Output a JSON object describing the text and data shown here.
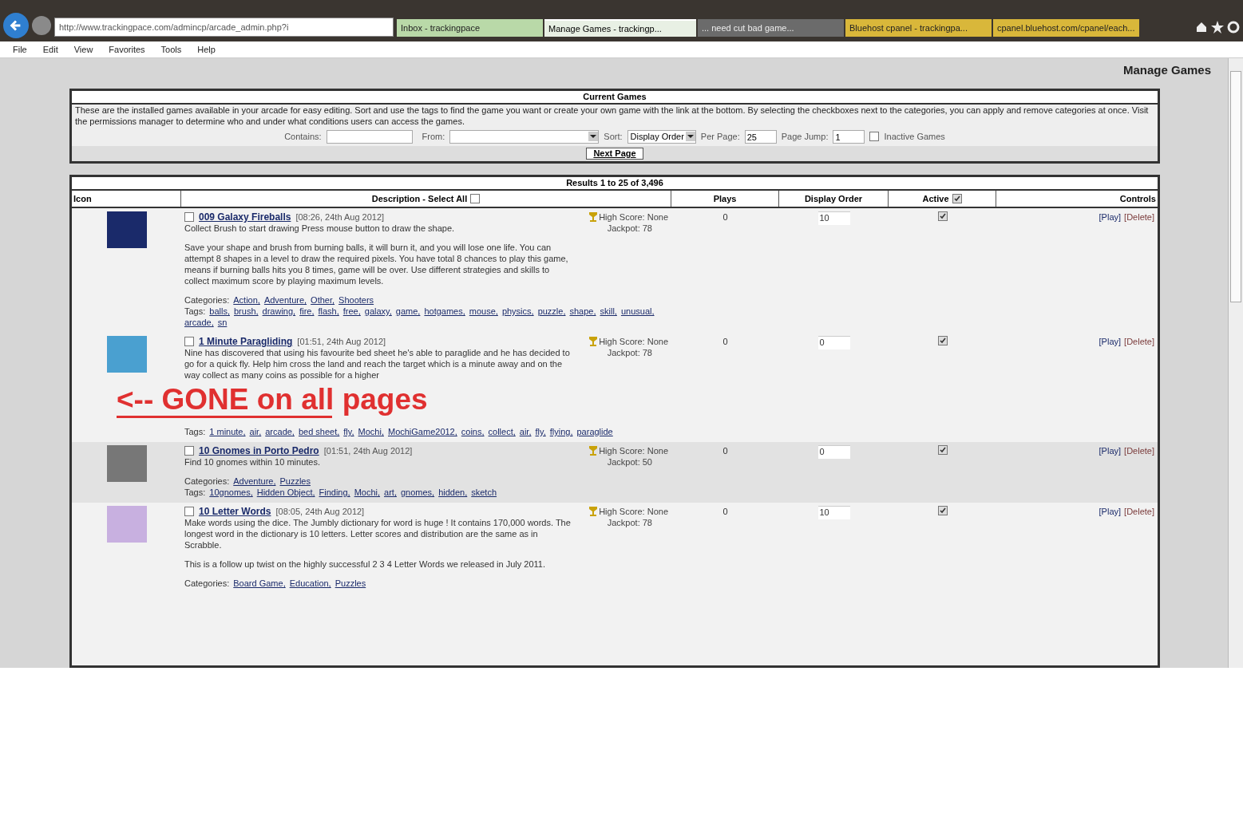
{
  "browser": {
    "address": "http://www.trackingpace.com/admincp/arcade_admin.php?i",
    "tabs": [
      {
        "label": "Inbox - trackingpace",
        "selected": false,
        "color": "#b9d9a8"
      },
      {
        "label": "Manage Games - trackingp...",
        "selected": true,
        "color": "#e8f0e4"
      },
      {
        "label": "... need cut bad game...",
        "selected": false,
        "color": "#6b6b6b"
      },
      {
        "label": "Bluehost cpanel - trackingpa...",
        "selected": false,
        "color": "#d9b73a"
      },
      {
        "label": "cpanel.bluehost.com/cpanel/each...",
        "selected": false,
        "color": "#d9b73a"
      }
    ],
    "menu": [
      "File",
      "Edit",
      "View",
      "Favorites",
      "Tools",
      "Help"
    ]
  },
  "page_title": "Manage Games",
  "panel": {
    "title": "Current Games",
    "description": "These are the installed games available in your arcade for easy editing. Sort and use the tags to find the game you want or create your own game with the link at the bottom. By selecting the checkboxes next to the categories, you can apply and remove categories at once. Visit the permissions manager to determine who and under what conditions users can access the games.",
    "contains_label": "Contains:",
    "from_label": "From:",
    "sort_label": "Sort:",
    "sort_value": "Display Order",
    "per_page_label": "Per Page:",
    "per_page_value": "25",
    "page_jump_label": "Page Jump:",
    "page_jump_value": "1",
    "inactive_label": "Inactive Games",
    "inactive_checked": false,
    "next_button": "Next Page"
  },
  "results": {
    "title": "Results 1 to 25 of 3,496",
    "columns": {
      "icon": "Icon",
      "description": "Description - Select All",
      "plays": "Plays",
      "display_order": "Display Order",
      "active": "Active",
      "controls": "Controls"
    },
    "select_all_checked": false,
    "active_all_checked": true,
    "rows": [
      {
        "title": "009 Galaxy Fireballs",
        "date": "[08:26, 24th Aug 2012]",
        "checked": false,
        "highlighted": false,
        "description": [
          "Collect Brush to start drawing Press mouse button to draw the shape.",
          "Save your shape and brush from burning balls, it will burn it, and you will lose one life. You can attempt 8 shapes in a level to draw the required pixels. You have total 8 chances to play this game, means if burning balls hits you 8 times, game will be over. Use different strategies and skills to collect maximum score by playing maximum levels."
        ],
        "categories_label": "Categories:",
        "categories": [
          "Action,",
          "Adventure,",
          "Other,",
          "Shooters"
        ],
        "tags_label": "Tags:",
        "tags": [
          "balls,",
          "brush,",
          "drawing,",
          "fire,",
          "flash,",
          "free,",
          "galaxy,",
          "game,",
          "hotgames,",
          "mouse,",
          "physics,",
          "puzzle,",
          "shape,",
          "skill,",
          "unusual,",
          "arcade,",
          "sn"
        ],
        "high_score": "High Score: None",
        "jackpot": "Jackpot: 78",
        "plays": "0",
        "display_order": "10",
        "active": true,
        "play": "[Play]",
        "delete": "[Delete]"
      },
      {
        "title": "1 Minute Paragliding",
        "date": "[01:51, 24th Aug 2012]",
        "checked": false,
        "highlighted": false,
        "description": [
          "Nine has discovered that using his favourite bed sheet he's able to paraglide and he has decided to go for a quick fly. Help him cross the land and reach the target which is a minute away and on the way collect as many coins as possible for a higher"
        ],
        "annotation": "<-- GONE on all pages",
        "tags_label": "Tags:",
        "tags": [
          "1 minute,",
          "air,",
          "arcade,",
          "bed sheet,",
          "fly,",
          "Mochi,",
          "MochiGame2012,",
          "coins,",
          "collect,",
          "air,",
          "fly,",
          "flying,",
          "paraglide"
        ],
        "high_score": "High Score: None",
        "jackpot": "Jackpot: 78",
        "plays": "0",
        "display_order": "0",
        "active": true,
        "play": "[Play]",
        "delete": "[Delete]"
      },
      {
        "title": "10 Gnomes in Porto Pedro",
        "date": "[01:51, 24th Aug 2012]",
        "checked": false,
        "highlighted": true,
        "description": [
          "Find 10 gnomes within 10 minutes."
        ],
        "categories_label": "Categories:",
        "categories": [
          "Adventure,",
          "Puzzles"
        ],
        "tags_label": "Tags:",
        "tags": [
          "10gnomes,",
          "Hidden Object,",
          "Finding,",
          "Mochi,",
          "art,",
          "gnomes,",
          "hidden,",
          "sketch"
        ],
        "high_score": "High Score: None",
        "jackpot": "Jackpot: 50",
        "plays": "0",
        "display_order": "0",
        "active": true,
        "play": "[Play]",
        "delete": "[Delete]"
      },
      {
        "title": "10 Letter Words",
        "date": "[08:05, 24th Aug 2012]",
        "checked": false,
        "highlighted": false,
        "description": [
          "Make words using the dice. The Jumbly dictionary for word is huge ! It contains 170,000 words. The longest word in the dictionary is 10 letters. Letter scores and distribution are the same as in Scrabble.",
          "This is a follow up twist on the highly successful 2 3 4 Letter Words we released in July 2011."
        ],
        "categories_label": "Categories:",
        "categories": [
          "Board Game,",
          "Education,",
          "Puzzles"
        ],
        "high_score": "High Score: None",
        "jackpot": "Jackpot: 78",
        "plays": "0",
        "display_order": "10",
        "active": true,
        "play": "[Play]",
        "delete": "[Delete]"
      }
    ]
  }
}
